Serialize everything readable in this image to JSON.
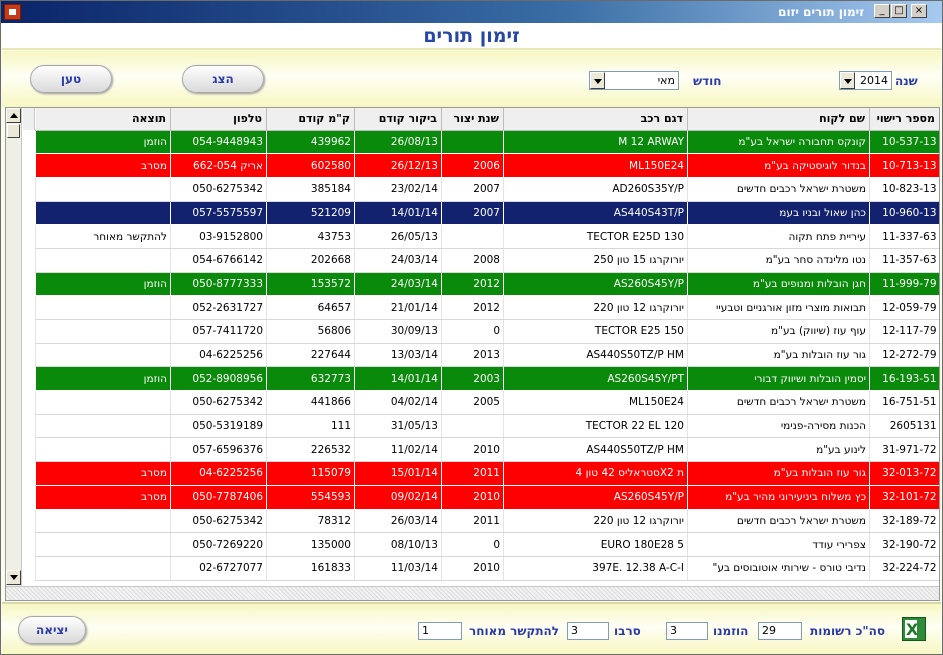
{
  "window": {
    "title": "זימון תורים יזום",
    "controls": {
      "minimize": "_",
      "maximize": "□",
      "close": "×"
    }
  },
  "header": {
    "title": "זימון תורים"
  },
  "toolbar": {
    "year_label": "שנה",
    "year_value": "2014",
    "month_label": "חודש",
    "month_value": "מאי",
    "show_button": "הצג",
    "load_button": "טען"
  },
  "colors": {
    "green": "#0a8a0a",
    "red": "#ff0000",
    "selected": "#12226e",
    "accent": "#2a3aa8"
  },
  "table": {
    "columns": [
      "מספר רישוי",
      "שם לקוח",
      "דגם רכב",
      "שנת יצור",
      "ביקור קודם",
      "ק\"מ קודם",
      "טלפון",
      "תוצאה"
    ],
    "rows": [
      {
        "style": "green",
        "cells": [
          "10-537-13",
          "קונקס תחבורה ישראל בע\"מ",
          "M 12 ARWAY",
          "",
          "26/08/13",
          "439962",
          "054-9448943",
          "הוזמן"
        ]
      },
      {
        "style": "red",
        "cells": [
          "10-713-13",
          "בנדור לוגיסטיקה בע\"מ",
          "ML150E24",
          "2006",
          "26/12/13",
          "602580",
          "אריק 662-054",
          "מסרב"
        ]
      },
      {
        "style": "",
        "cells": [
          "10-823-13",
          "משטרת ישראל רכבים חדשים",
          "AD260S35Y/P",
          "2007",
          "23/02/14",
          "385184",
          "050-6275342",
          ""
        ]
      },
      {
        "style": "sel",
        "cells": [
          "10-960-13",
          "כהן שאול ובניו בעמ",
          "AS440S43T/P",
          "2007",
          "14/01/14",
          "521209",
          "057-5575597",
          ""
        ]
      },
      {
        "style": "",
        "cells": [
          "11-337-63",
          "עיריית פתח תקוה",
          "TECTOR E25D 130",
          "",
          "26/05/13",
          "43753",
          "03-9152800",
          "להתקשר מאוחר"
        ]
      },
      {
        "style": "",
        "cells": [
          "11-357-63",
          "נטו מלינדה סחר בע\"מ",
          "יורוקרגו 15 טון 250",
          "2008",
          "24/03/14",
          "202668",
          "054-6766142",
          ""
        ]
      },
      {
        "style": "green",
        "cells": [
          "11-999-79",
          "חגן הובלות ומנופים בע\"מ",
          "AS260S45Y/P",
          "2012",
          "24/03/14",
          "153572",
          "050-8777333",
          "הוזמן"
        ]
      },
      {
        "style": "",
        "cells": [
          "12-059-79",
          "תבואות מוצרי מזון אורגניים וטבעיי",
          "יורוקרגו 12 טון 220",
          "2012",
          "21/01/14",
          "64657",
          "052-2631727",
          ""
        ]
      },
      {
        "style": "",
        "cells": [
          "12-117-79",
          "עוף עוז (שיווק) בע\"מ",
          "TECTOR E25 150",
          "0",
          "30/09/13",
          "56806",
          "057-7411720",
          ""
        ]
      },
      {
        "style": "",
        "cells": [
          "12-272-79",
          "גור עוז הובלות בע\"מ",
          "AS440S50TZ/P HM",
          "2013",
          "13/03/14",
          "227644",
          "04-6225256",
          ""
        ]
      },
      {
        "style": "green",
        "cells": [
          "16-193-51",
          "יסמין הובלות ושיווק דבורי",
          "AS260S45Y/PT",
          "2003",
          "14/01/14",
          "632773",
          "052-8908956",
          "הוזמן"
        ]
      },
      {
        "style": "",
        "cells": [
          "16-751-51",
          "משטרת ישראל רכבים חדשים",
          "ML150E24",
          "2005",
          "04/02/14",
          "441866",
          "050-6275342",
          ""
        ]
      },
      {
        "style": "",
        "cells": [
          "2605131",
          "הכנות מסירה-פנימי",
          "TECTOR 22 EL 120",
          "",
          "31/05/13",
          "111",
          "050-5319189",
          ""
        ]
      },
      {
        "style": "",
        "cells": [
          "31-971-72",
          "לינוע בע\"מ",
          "AS440S50TZ/P HM",
          "2010",
          "11/02/14",
          "226532",
          "057-6596376",
          ""
        ]
      },
      {
        "style": "red",
        "cells": [
          "32-013-72",
          "גור עוז הובלות בע\"מ",
          "סטראליס 42 טון 4X2 ת",
          "2011",
          "15/01/14",
          "115079",
          "04-6225256",
          "מסרב"
        ]
      },
      {
        "style": "red",
        "cells": [
          "32-101-72",
          "כץ משלוח ביניעירוני מהיר בע\"מ",
          "AS260S45Y/P",
          "2010",
          "09/02/14",
          "554593",
          "050-7787406",
          "מסרב"
        ]
      },
      {
        "style": "",
        "cells": [
          "32-189-72",
          "משטרת ישראל רכבים חדשים",
          "יורוקרגו 12 טון 220",
          "2011",
          "26/03/14",
          "78312",
          "050-6275342",
          ""
        ]
      },
      {
        "style": "",
        "cells": [
          "32-190-72",
          "צפרירי עודד",
          "EURO 180E28 5",
          "0",
          "08/10/13",
          "135000",
          "050-7269220",
          ""
        ]
      },
      {
        "style": "",
        "cells": [
          "32-224-72",
          "נדיבי טורס - שירותי אוטובוסים בע\"",
          "397E. 12.38 A-C-I",
          "2010",
          "11/03/14",
          "161833",
          "02-6727077",
          ""
        ]
      }
    ]
  },
  "footer": {
    "total_label": "סה\"כ רשומות",
    "total_value": "29",
    "invited_label": "הוזמנו",
    "invited_value": "3",
    "refused_label": "סרבו",
    "refused_value": "3",
    "call_later_label": "להתקשר מאוחר",
    "call_later_value": "1",
    "exit_button": "יציאה",
    "excel_icon": "excel-icon"
  }
}
